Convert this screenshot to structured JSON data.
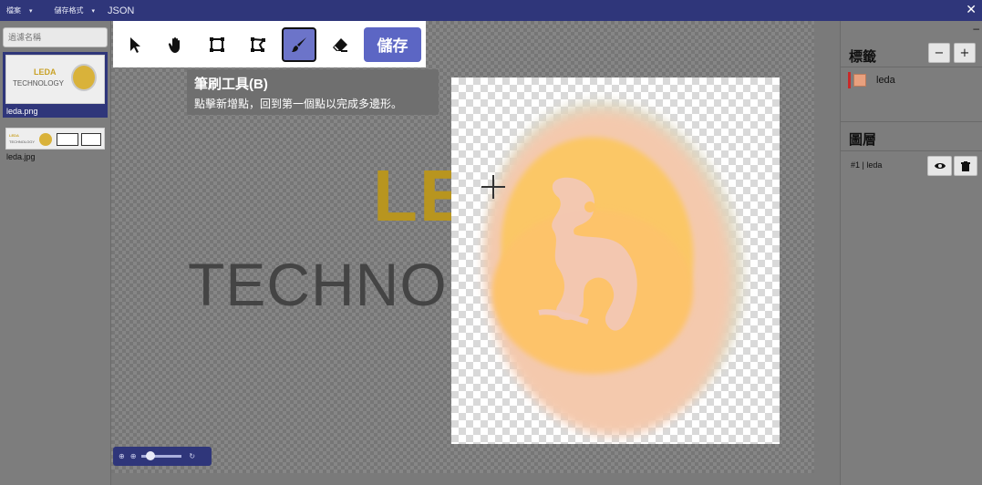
{
  "topbar": {
    "menus": [
      {
        "label": "檔案"
      },
      {
        "label": "儲存格式"
      }
    ],
    "json_label": "JSON",
    "close": "✕"
  },
  "sidebar": {
    "filter_placeholder": "過濾名稱",
    "files": [
      {
        "name": "leda.png",
        "active": true,
        "thumb_text_1": "LEDA",
        "thumb_text_2": "TECHNOLOGY"
      },
      {
        "name": "leda.jpg",
        "active": false,
        "thumb_text_1": "LEDA",
        "thumb_text_2": "TECHNOLOGY"
      }
    ]
  },
  "toolbar": {
    "tools": [
      {
        "name": "select",
        "icon": "pointer-icon"
      },
      {
        "name": "pan",
        "icon": "hand-icon"
      },
      {
        "name": "bounding-box",
        "icon": "box-icon"
      },
      {
        "name": "polygon",
        "icon": "polygon-icon"
      },
      {
        "name": "brush",
        "icon": "brush-icon",
        "selected": true
      },
      {
        "name": "eraser",
        "icon": "eraser-icon"
      }
    ],
    "save_label": "儲存"
  },
  "tooltip": {
    "title": "筆刷工具(B)",
    "description": "點擊新增點，回到第一個點以完成多邊形。"
  },
  "canvas": {
    "bg_text_1": "LEDA",
    "bg_text_2": "TECHNOLO",
    "accent": "#b8951f"
  },
  "zoom": {
    "zoom_in": "⊕",
    "zoom_out": "⊕",
    "reset": "↻"
  },
  "right_panel": {
    "minimize": "–",
    "labels_title": "標籤",
    "minus": "−",
    "plus": "+",
    "labels": [
      {
        "name": "leda",
        "color": "#e8a07e",
        "bar_color": "#c82a2a"
      }
    ],
    "layers_title": "圖層",
    "layers": [
      {
        "text": "#1 | leda"
      }
    ]
  },
  "colors": {
    "brand": "#2f367a",
    "save_button": "#5c66c4",
    "selected_tool": "#6c74c9"
  }
}
